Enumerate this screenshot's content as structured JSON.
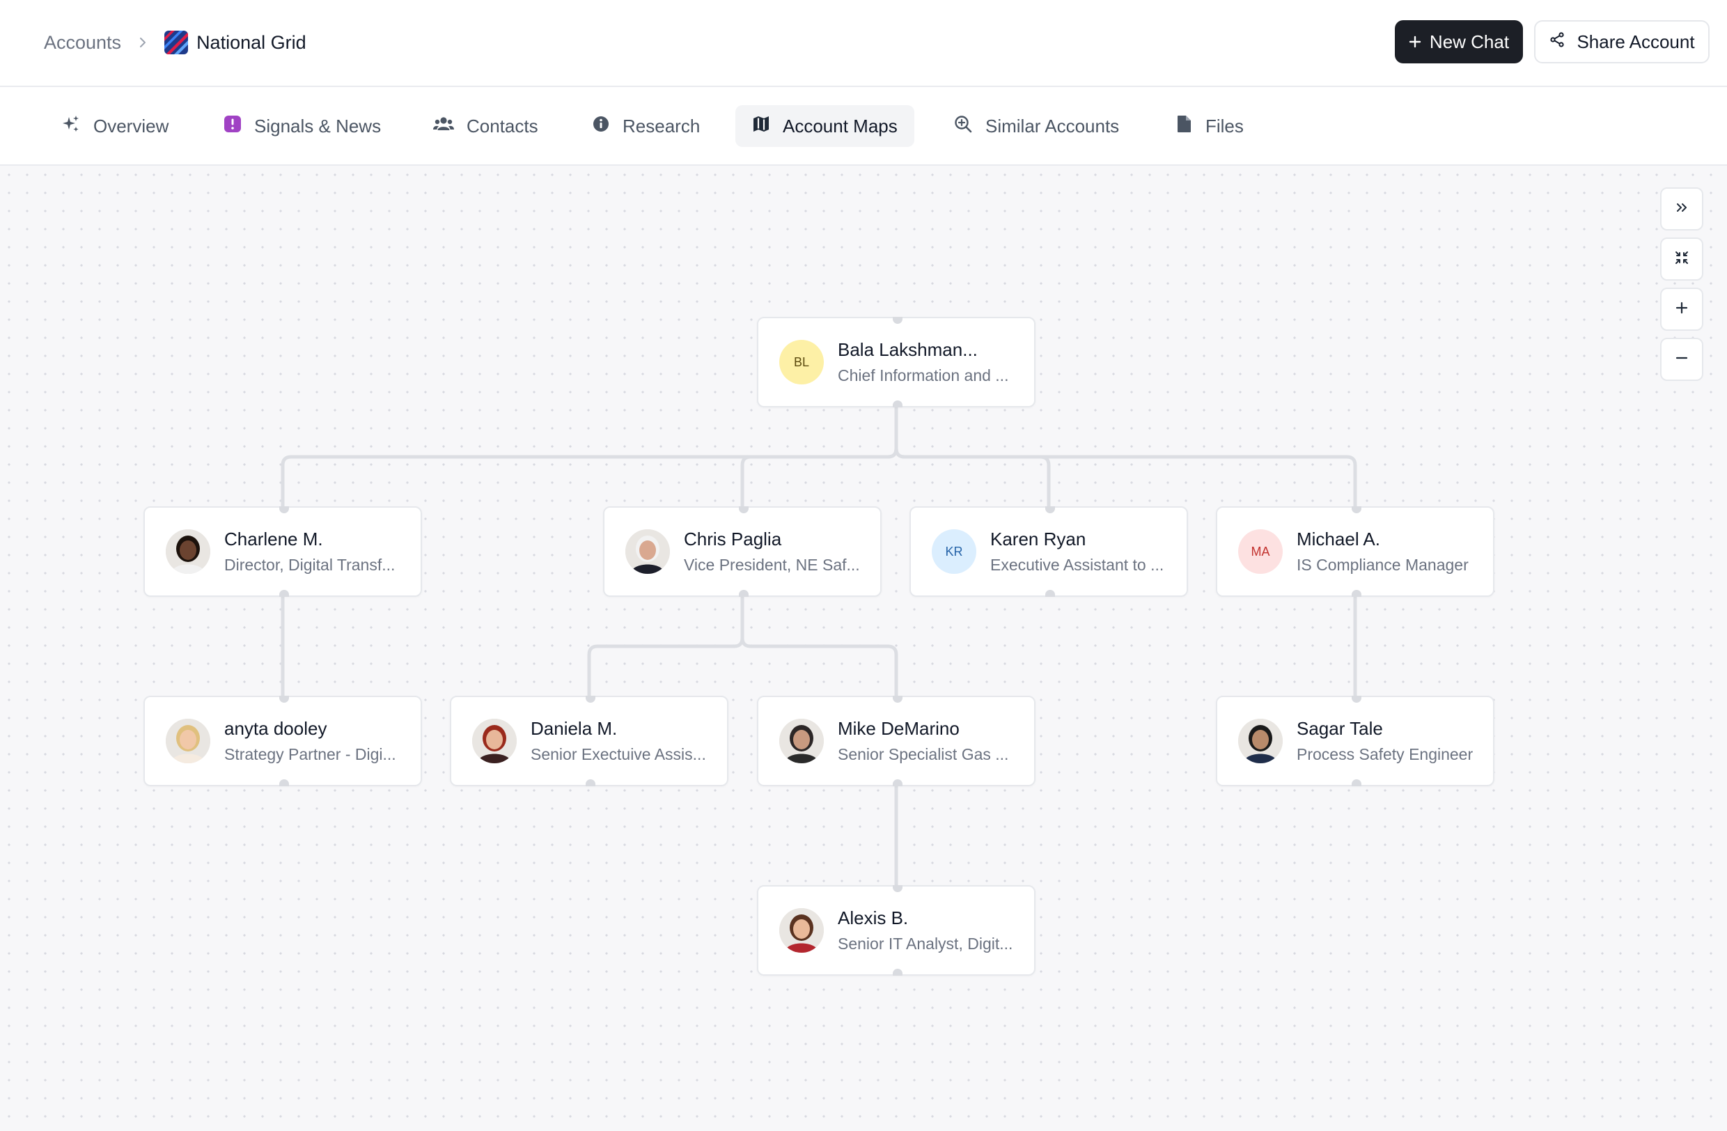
{
  "breadcrumb": {
    "parent": "Accounts",
    "current": "National Grid"
  },
  "header": {
    "new_chat_label": "New Chat",
    "share_label": "Share Account"
  },
  "tabs": [
    {
      "label": "Overview",
      "icon": "sparkle-icon"
    },
    {
      "label": "Signals & News",
      "icon": "alert-square-icon"
    },
    {
      "label": "Contacts",
      "icon": "users-icon"
    },
    {
      "label": "Research",
      "icon": "info-circle-icon"
    },
    {
      "label": "Account Maps",
      "icon": "map-icon",
      "active": true
    },
    {
      "label": "Similar Accounts",
      "icon": "search-plus-icon"
    },
    {
      "label": "Files",
      "icon": "file-icon"
    }
  ],
  "org_chart": {
    "nodes": [
      {
        "id": "bl",
        "name": "Bala Lakshman...",
        "title": "Chief Information and ...",
        "initials": "BL",
        "avatar_bg": "#fdf0a6",
        "avatar_fg": "#5b4a0e"
      },
      {
        "id": "cm",
        "name": "Charlene M.",
        "title": "Director, Digital Transf...",
        "photo": true,
        "skin": "#6b4330",
        "hair": "#1c120c",
        "shirt": "#f1f1f1"
      },
      {
        "id": "cp",
        "name": "Chris Paglia",
        "title": "Vice President, NE Saf...",
        "photo": true,
        "skin": "#d9a890",
        "hair": "#f2f2f2",
        "shirt": "#1d1f2b"
      },
      {
        "id": "kr",
        "name": "Karen Ryan",
        "title": "Executive Assistant to ...",
        "initials": "KR",
        "avatar_bg": "#dbeefe",
        "avatar_fg": "#2563a8"
      },
      {
        "id": "ma",
        "name": "Michael A.",
        "title": "IS Compliance Manager",
        "initials": "MA",
        "avatar_bg": "#fde1e1",
        "avatar_fg": "#c2322e"
      },
      {
        "id": "ad",
        "name": "anyta dooley",
        "title": "Strategy Partner - Digi...",
        "photo": true,
        "skin": "#f1c8a8",
        "hair": "#e0c07e",
        "shirt": "#f5ebe0"
      },
      {
        "id": "dm",
        "name": "Daniela M.",
        "title": "Senior Exectuive Assis...",
        "photo": true,
        "skin": "#e8b79a",
        "hair": "#9a2a1c",
        "shirt": "#3a2020"
      },
      {
        "id": "md",
        "name": "Mike DeMarino",
        "title": "Senior Specialist Gas ...",
        "photo": true,
        "skin": "#c99a80",
        "hair": "#2c2626",
        "shirt": "#2a2a2a"
      },
      {
        "id": "st",
        "name": "Sagar Tale",
        "title": "Process Safety Engineer",
        "photo": true,
        "skin": "#b98b6b",
        "hair": "#1a1a1a",
        "shirt": "#1f2d4a"
      },
      {
        "id": "ab",
        "name": "Alexis B.",
        "title": "Senior IT Analyst, Digit...",
        "photo": true,
        "skin": "#e9b99a",
        "hair": "#5a3220",
        "shirt": "#b3262e"
      }
    ],
    "edges": [
      [
        "bl",
        "cm"
      ],
      [
        "bl",
        "cp"
      ],
      [
        "bl",
        "kr"
      ],
      [
        "bl",
        "ma"
      ],
      [
        "cm",
        "ad"
      ],
      [
        "cp",
        "dm"
      ],
      [
        "cp",
        "md"
      ],
      [
        "ma",
        "st"
      ],
      [
        "md",
        "ab"
      ]
    ]
  },
  "controls": [
    {
      "name": "expand-panel-button",
      "icon": "chevrons-right-icon"
    },
    {
      "name": "fit-view-button",
      "icon": "collapse-icon"
    },
    {
      "name": "zoom-in-button",
      "icon": "plus-icon"
    },
    {
      "name": "zoom-out-button",
      "icon": "minus-icon"
    }
  ]
}
